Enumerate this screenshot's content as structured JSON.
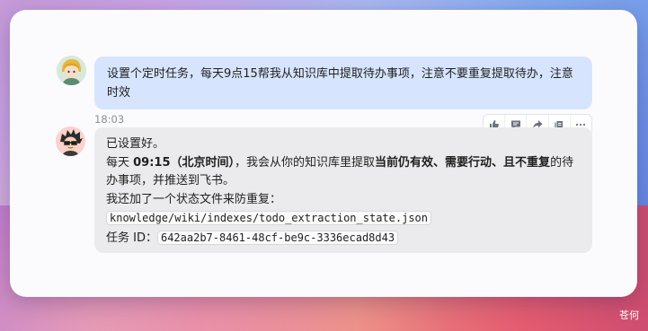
{
  "user_message": {
    "text": "设置个定时任务，每天9点15帮我从知识库中提取待办事项，注意不要重复提取待办，注意时效"
  },
  "timestamp": "18:03",
  "actions": [
    "thumbs-up-icon",
    "comment-icon",
    "share-icon",
    "copy-icon",
    "more-icon"
  ],
  "bot_message": {
    "line1": "已设置好。",
    "line2_pre": "每天 ",
    "line2_time": "09:15（北京时间）",
    "line2_mid": "，我会从你的知识库里提取",
    "line2_bold": "当前仍有效、需要行动、且不重复",
    "line2_post": "的待办事项，并推送到飞书。",
    "line3": "我还加了一个状态文件来防重复：",
    "state_path": "knowledge/wiki/indexes/todo_extraction_state.json",
    "task_id_label": "任务 ID：",
    "task_id": "642aa2b7-8461-48cf-be9c-3336ecad8d43"
  },
  "watermark": "苍何"
}
